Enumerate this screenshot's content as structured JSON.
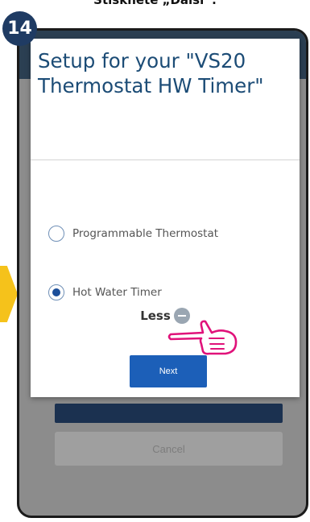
{
  "caption": "Stiskněte „Další“.",
  "step_number": "14",
  "dialog": {
    "title": "Setup for your \"VS20 Thermostat HW Timer\"",
    "options": [
      {
        "label": "Programmable Thermostat",
        "selected": false
      },
      {
        "label": "Hot Water Timer",
        "selected": true
      }
    ],
    "less_label": "Less",
    "next_label": "Next"
  },
  "background": {
    "cancel_label": "Cancel"
  },
  "icons": [
    "minus-icon",
    "pointing-hand-icon"
  ],
  "colors": {
    "badge": "#1f3b63",
    "title": "#1c4c76",
    "next_button": "#1c5fb8",
    "arrow": "#f5c21b",
    "hand_outline": "#e0127a"
  }
}
